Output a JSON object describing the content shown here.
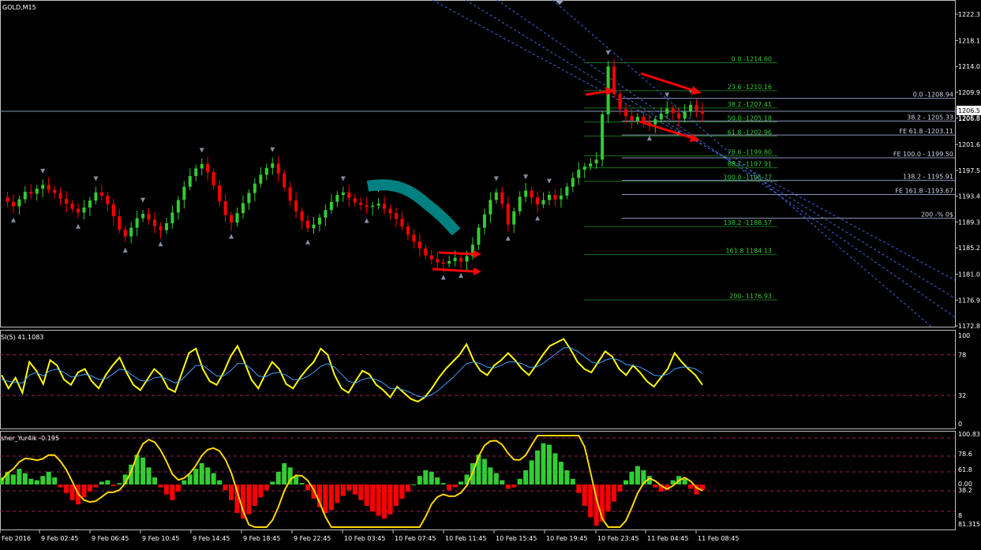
{
  "window": {
    "symbol_title": "GOLD,M15"
  },
  "indicators": {
    "rsi_label": "SI(5) 41.1083",
    "fisher_label": "sher_Yur4ik -0.195"
  },
  "colors": {
    "background": "#000000",
    "bull_candle": "#32cd32",
    "bear_candle": "#ff0000",
    "fib_line": "#1e6e1e",
    "fe_line": "#8a93b8",
    "channel": "#4169e1",
    "annotation_arrow": "#ff0000",
    "teal_stroke": "#008080",
    "rsi_yellow": "#ffff00",
    "rsi_blue": "#0000cd",
    "fisher_green": "#32cd32",
    "fisher_red": "#ff0000",
    "fisher_line": "#ffd700"
  },
  "chart_data": [
    {
      "type": "candlestick",
      "title": "GOLD,M15",
      "y_axis_ticks": [
        "1222.3",
        "1218.1",
        "1214.0",
        "1209.9",
        "1205.8",
        "1201.6",
        "1197.5",
        "1193.4",
        "1189.3",
        "1185.2",
        "1181.0",
        "1176.9",
        "1172.8"
      ],
      "current_price_labels": [
        "1206.5",
        "1206.5"
      ],
      "x_axis_ticks": [
        "Feb 2016",
        "9 Feb 02:45",
        "9 Feb 06:45",
        "9 Feb 10:45",
        "9 Feb 14:45",
        "9 Feb 18:45",
        "9 Feb 22:45",
        "10 Feb 03:45",
        "10 Feb 07:45",
        "10 Feb 11:45",
        "10 Feb 15:45",
        "10 Feb 19:45",
        "10 Feb 23:45",
        "11 Feb 04:45",
        "11 Feb 08:45"
      ],
      "close_path": [
        1193.2,
        1192.5,
        1191.8,
        1192.9,
        1194.1,
        1193.8,
        1194.6,
        1195.2,
        1194.4,
        1193.9,
        1193.0,
        1192.2,
        1191.4,
        1190.8,
        1191.6,
        1192.7,
        1194.0,
        1193.5,
        1192.1,
        1190.2,
        1188.1,
        1187.0,
        1188.4,
        1189.9,
        1190.6,
        1189.7,
        1188.6,
        1188.0,
        1189.1,
        1190.8,
        1192.8,
        1194.9,
        1196.6,
        1197.8,
        1198.5,
        1197.2,
        1195.1,
        1192.6,
        1190.4,
        1189.2,
        1190.7,
        1192.3,
        1193.9,
        1195.4,
        1196.8,
        1197.9,
        1198.6,
        1197.0,
        1194.8,
        1192.7,
        1191.0,
        1189.5,
        1188.3,
        1188.9,
        1190.0,
        1191.2,
        1192.5,
        1193.6,
        1194.0,
        1193.1,
        1192.4,
        1192.0,
        1191.7,
        1191.9,
        1192.2,
        1191.4,
        1190.7,
        1189.8,
        1188.6,
        1187.3,
        1186.2,
        1185.1,
        1184.0,
        1183.4,
        1182.9,
        1182.7,
        1183.1,
        1183.6,
        1183.0,
        1183.9,
        1185.7,
        1188.4,
        1190.5,
        1192.8,
        1194.0,
        1192.2,
        1188.9,
        1191.0,
        1193.3,
        1194.3,
        1193.2,
        1192.1,
        1192.8,
        1193.6,
        1192.9,
        1193.5,
        1194.9,
        1196.3,
        1197.6,
        1198.1,
        1198.6,
        1199.2,
        1206.4,
        1214.0,
        1209.6,
        1207.2,
        1206.1,
        1205.4,
        1206.0,
        1205.2,
        1204.8,
        1205.6,
        1206.5,
        1207.3,
        1206.6,
        1205.7,
        1206.8,
        1207.9,
        1207.0,
        1206.5
      ],
      "fibonacci_levels": [
        {
          "label": "0.0 -1214.60",
          "value": 1214.6
        },
        {
          "label": "23.6 -1210.16",
          "value": 1210.16
        },
        {
          "label": "38.2 -1207.41",
          "value": 1207.41
        },
        {
          "label": "50.0 -1205.18",
          "value": 1205.18
        },
        {
          "label": "61.8 -1202.96",
          "value": 1202.96
        },
        {
          "label": "78.6 -1199.80",
          "value": 1199.8
        },
        {
          "label": "88.1 -1197.91",
          "value": 1197.91
        },
        {
          "label": "100.0 -1195.77",
          "value": 1195.77
        },
        {
          "label": "138.2 -1188.57",
          "value": 1188.57
        },
        {
          "label": "161.8 1184.13",
          "value": 1184.13
        },
        {
          "label": "200- 1176.93",
          "value": 1176.93
        }
      ],
      "fibonacci_expansion_levels": [
        {
          "label": "0.0 -1208.94",
          "value": 1208.94
        },
        {
          "label": "38.2 - 1205.33",
          "value": 1205.33
        },
        {
          "label": "FE 61.8 -1203.11",
          "value": 1203.11
        },
        {
          "label": "FE 100.0 - 1199.50",
          "value": 1199.5
        },
        {
          "label": "138.2 - 1195.91",
          "value": 1195.91
        },
        {
          "label": "FE 161.8 -1193.67",
          "value": 1193.67
        },
        {
          "label": "200 -% 0$",
          "value": 1189.9
        }
      ]
    },
    {
      "type": "line",
      "title": "SI(5) 41.1083",
      "y_axis_ticks": [
        "100",
        "78",
        "32",
        "0"
      ],
      "ylim": [
        0,
        100
      ],
      "series": [
        {
          "values": [
            55,
            40,
            52,
            35,
            70,
            60,
            45,
            72,
            66,
            50,
            44,
            58,
            62,
            48,
            40,
            55,
            66,
            75,
            58,
            44,
            38,
            50,
            62,
            55,
            40,
            36,
            58,
            80,
            85,
            62,
            48,
            44,
            58,
            76,
            88,
            70,
            50,
            40,
            56,
            70,
            62,
            45,
            40,
            52,
            62,
            70,
            85,
            78,
            55,
            40,
            35,
            48,
            60,
            56,
            44,
            38,
            30,
            42,
            35,
            28,
            25,
            30,
            40,
            52,
            62,
            70,
            78,
            90,
            72,
            60,
            55,
            66,
            72,
            80,
            72,
            62,
            55,
            66,
            78,
            88,
            92,
            96,
            84,
            70,
            62,
            58,
            70,
            82,
            76,
            62,
            55,
            66,
            58,
            48,
            42,
            52,
            62,
            80,
            70,
            62,
            55,
            44
          ]
        },
        {
          "values": [
            50,
            48,
            47,
            46,
            55,
            58,
            54,
            60,
            62,
            58,
            53,
            54,
            56,
            54,
            50,
            51,
            56,
            62,
            60,
            54,
            49,
            48,
            52,
            53,
            50,
            46,
            50,
            58,
            66,
            66,
            60,
            54,
            54,
            60,
            68,
            68,
            62,
            54,
            53,
            57,
            58,
            55,
            50,
            50,
            53,
            58,
            65,
            68,
            64,
            56,
            48,
            46,
            50,
            52,
            50,
            46,
            40,
            40,
            38,
            35,
            31,
            30,
            33,
            38,
            45,
            52,
            60,
            68,
            70,
            68,
            64,
            63,
            66,
            70,
            70,
            68,
            64,
            64,
            68,
            74,
            80,
            86,
            86,
            82,
            76,
            70,
            68,
            72,
            74,
            72,
            67,
            66,
            64,
            60,
            55,
            54,
            56,
            62,
            64,
            64,
            62,
            57
          ]
        }
      ]
    },
    {
      "type": "bar",
      "title": "sher_Yur4ik -0.195",
      "y_axis_ticks": [
        "100.83",
        "78.6",
        "61.8",
        "0.00",
        "38.2",
        "8",
        "81.315"
      ],
      "histogram_values": [
        10,
        18,
        14,
        22,
        16,
        8,
        6,
        12,
        18,
        10,
        -4,
        -12,
        -22,
        -28,
        -18,
        -10,
        -4,
        4,
        6,
        -2,
        2,
        14,
        28,
        42,
        38,
        24,
        10,
        -4,
        -14,
        -22,
        -10,
        6,
        14,
        22,
        30,
        24,
        16,
        6,
        -8,
        -22,
        -40,
        -48,
        -42,
        -30,
        -18,
        -8,
        4,
        18,
        30,
        24,
        12,
        2,
        -8,
        -20,
        -32,
        -40,
        -36,
        -26,
        -16,
        -8,
        -14,
        -22,
        -30,
        -38,
        -44,
        -48,
        -42,
        -30,
        -20,
        -10,
        0,
        12,
        20,
        18,
        10,
        2,
        -8,
        -4,
        4,
        14,
        30,
        42,
        36,
        24,
        16,
        6,
        -6,
        -4,
        8,
        20,
        34,
        48,
        58,
        56,
        44,
        32,
        20,
        8,
        -12,
        -30,
        -46,
        -58,
        -52,
        -38,
        -24,
        -10,
        6,
        18,
        26,
        20,
        12,
        -4,
        -10,
        -8,
        6,
        12,
        8,
        -6,
        -14,
        -8
      ]
    }
  ]
}
